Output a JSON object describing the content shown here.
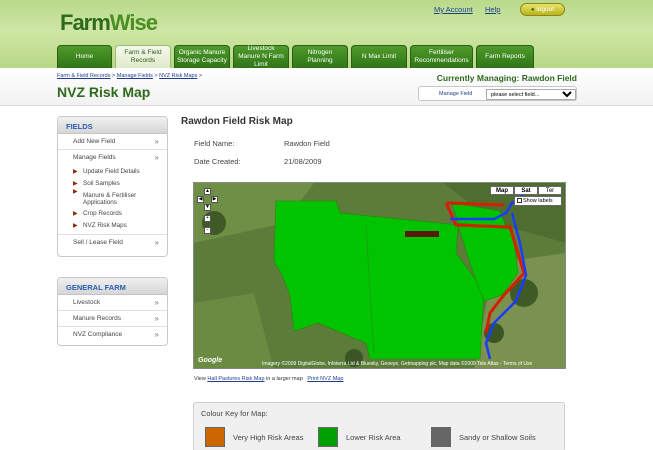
{
  "brand": {
    "farm": "Farm",
    "wise": "Wise"
  },
  "top_links": {
    "my_account": "My Account",
    "help": "Help",
    "logout": "logout"
  },
  "tabs": [
    {
      "label": "Home",
      "active": false
    },
    {
      "label": "Farm & Field Records",
      "active": true
    },
    {
      "label": "Organic Manure Storage Capacity",
      "active": false
    },
    {
      "label": "Livestock Manure N Farm Limit",
      "active": false
    },
    {
      "label": "Nitrogen Planning",
      "active": false
    },
    {
      "label": "N Max Limit",
      "active": false
    },
    {
      "label": "Fertiliser Recommendations",
      "active": false
    },
    {
      "label": "Farm Reports",
      "active": false
    }
  ],
  "breadcrumb": [
    "Farm & Field Records",
    "Manage Fields",
    "NVZ Risk Maps"
  ],
  "breadcrumb_sep": ">",
  "page_title": "NVZ Risk Map",
  "managing": "Currently Managing: Rawdon Field",
  "manage_field": {
    "label": "Manage Field",
    "selected": "please select field..."
  },
  "sidebar": {
    "fields_title": "FIELDS",
    "add_new_field": "Add New Field",
    "manage_fields": "Manage Fields",
    "sub_items": [
      "Update Field Details",
      "Soil Samples",
      "Manure & Fertiliser Applications",
      "Crop Records",
      "NVZ Risk Maps"
    ],
    "sell_lease": "Sell / Lease Field",
    "general_title": "GENERAL FARM",
    "general_items": [
      "Livestock",
      "Manure Records",
      "NVZ Compliance"
    ]
  },
  "main": {
    "title": "Rawdon Field Risk Map",
    "field_name_label": "Field Name:",
    "field_name_value": "Rawdon Field",
    "date_label": "Date Created:",
    "date_value": "21/08/2009"
  },
  "map": {
    "types": [
      "Map",
      "Sat",
      "Ter"
    ],
    "selected_type": "Sat",
    "show_labels": "Show labels",
    "copyright": "Imagery ©2009 DigitalGlobe, Infoterra Ltd & Bluesky, Geoeye, Getmapping plc, Map data ©2009 Tele Atlas - Terms of Use",
    "google": "Google"
  },
  "map_links": {
    "view_prefix": "View",
    "link_text": "Hall Pastures Risk Map",
    "suffix": "in a larger map",
    "print": "Print NVZ Map"
  },
  "key": {
    "title": "Colour Key for Map:",
    "items": [
      {
        "label": "Very High Risk Areas",
        "color": "#cc6600"
      },
      {
        "label": "Lower Risk Area",
        "color": "#00a000"
      },
      {
        "label": "Sandy or Shallow Soils",
        "color": "#666666"
      }
    ]
  },
  "colors": {
    "brand_green": "#2e6a1c",
    "link_blue": "#1e3f8a",
    "field_green": "#00cc00",
    "risk_red": "#cc2200",
    "water_blue": "#1a3cff"
  }
}
